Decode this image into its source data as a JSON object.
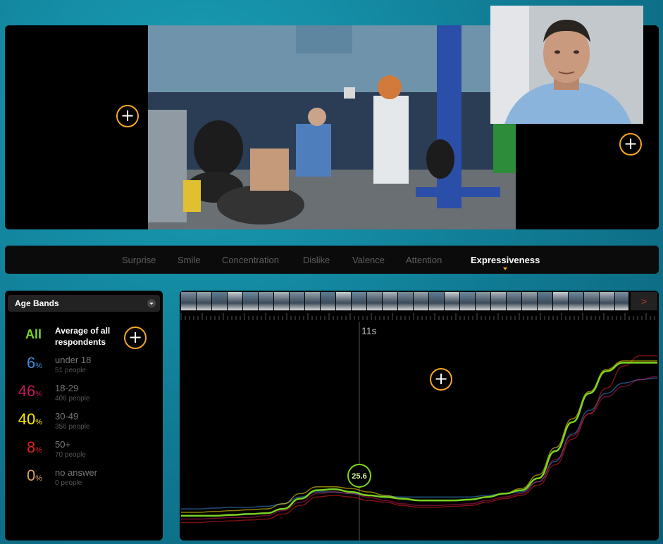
{
  "tabs": [
    {
      "label": "Surprise",
      "active": false
    },
    {
      "label": "Smile",
      "active": false
    },
    {
      "label": "Concentration",
      "active": false
    },
    {
      "label": "Dislike",
      "active": false
    },
    {
      "label": "Valence",
      "active": false
    },
    {
      "label": "Attention",
      "active": false
    },
    {
      "label": "Expressiveness",
      "active": true
    }
  ],
  "age_panel": {
    "dropdown_label": "Age Bands",
    "all": {
      "pct": "All",
      "label": "Average of all respondents",
      "color": "#7ed321"
    },
    "bands": [
      {
        "pct": "6",
        "unit": "%",
        "label": "under 18",
        "count": "51 people",
        "color": "#3b8fe0"
      },
      {
        "pct": "46",
        "unit": "%",
        "label": "18-29",
        "count": "406 people",
        "color": "#c2185b"
      },
      {
        "pct": "40",
        "unit": "%",
        "label": "30-49",
        "count": "356 people",
        "color": "#ffeb00"
      },
      {
        "pct": "8",
        "unit": "%",
        "label": "50+",
        "count": "70 people",
        "color": "#e02020"
      },
      {
        "pct": "0",
        "unit": "%",
        "label": "no answer",
        "count": "0 people",
        "color": "#d9a066"
      }
    ]
  },
  "timeline": {
    "cursor_time": "11s",
    "cursor_value": "25.6"
  },
  "chart_data": {
    "type": "line",
    "x": [
      0,
      1,
      2,
      3,
      4,
      5,
      6,
      7,
      8,
      9,
      10,
      11,
      12,
      13,
      14,
      15,
      16,
      17,
      18,
      19,
      20,
      21,
      22,
      23,
      24,
      25,
      26,
      27,
      28
    ],
    "series": [
      {
        "color": "#7ed321",
        "values": [
          10,
          10,
          10,
          10.5,
          11,
          11.5,
          14,
          20,
          25,
          25.6,
          24,
          22,
          21,
          20,
          19,
          19,
          19,
          19.5,
          21,
          23,
          25,
          32,
          48,
          65,
          82,
          95,
          100,
          100,
          100
        ]
      },
      {
        "color": "#c2185b",
        "values": [
          8,
          8,
          8.5,
          9,
          9,
          10,
          13,
          18,
          23,
          24,
          23,
          21,
          19,
          17,
          16,
          16,
          16.5,
          17,
          19,
          21,
          23,
          30,
          43,
          57,
          70,
          80,
          86,
          90,
          92
        ]
      },
      {
        "color": "#ffeb00",
        "values": [
          12,
          12,
          12.5,
          13,
          13.5,
          14,
          17,
          23,
          27,
          27,
          26,
          24,
          22,
          20,
          19,
          19,
          19,
          19.5,
          21,
          23,
          26,
          34,
          50,
          67,
          83,
          96,
          101,
          101,
          101
        ]
      },
      {
        "color": "#e02020",
        "values": [
          6,
          6,
          6.5,
          7,
          7.5,
          8,
          11,
          16,
          21,
          22,
          21,
          19,
          18,
          16,
          15,
          15,
          15.5,
          16,
          18,
          20,
          22,
          28,
          40,
          55,
          70,
          85,
          98,
          104,
          104
        ]
      },
      {
        "color": "#3b8fe0",
        "values": [
          14,
          14,
          14.5,
          15,
          15,
          15.5,
          17,
          21,
          24,
          24,
          23,
          22,
          21.5,
          21,
          21,
          21,
          21,
          21,
          22,
          23,
          24,
          30,
          42,
          58,
          72,
          82,
          88,
          90,
          91
        ]
      }
    ],
    "ylim": [
      0,
      120
    ]
  },
  "colors": {
    "accent": "#f5a623"
  }
}
